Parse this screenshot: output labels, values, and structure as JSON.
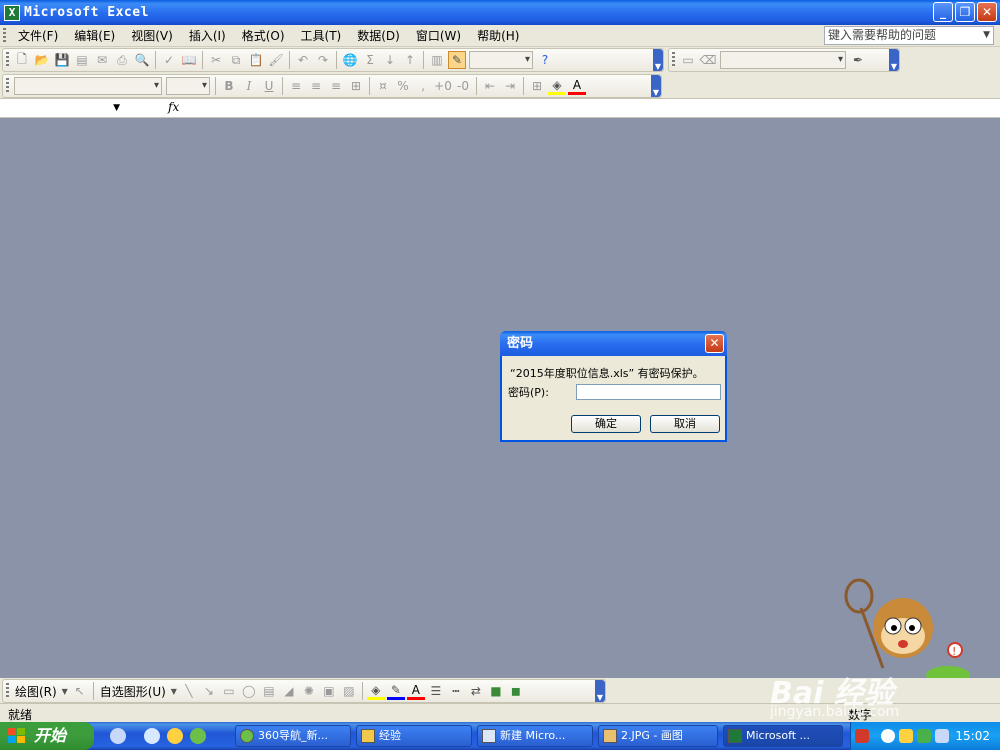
{
  "window": {
    "title": "Microsoft Excel",
    "app_icon": "X",
    "buttons": {
      "minimize": "_",
      "restore": "❐",
      "close": "✕"
    }
  },
  "menu": {
    "items": [
      "文件(F)",
      "编辑(E)",
      "视图(V)",
      "插入(I)",
      "格式(O)",
      "工具(T)",
      "数据(D)",
      "窗口(W)",
      "帮助(H)"
    ],
    "help_placeholder": "键入需要帮助的问题"
  },
  "formula_bar": {
    "fx_label": "fx"
  },
  "dialog": {
    "title": "密码",
    "message": "“2015年度职位信息.xls” 有密码保护。",
    "password_label": "密码(P):",
    "password_value": "",
    "ok_label": "确定",
    "cancel_label": "取消"
  },
  "drawing_toolbar": {
    "draw_label": "绘图(R)",
    "autoshapes_label": "自选图形(U)"
  },
  "status": {
    "left": "就绪",
    "right": "数字"
  },
  "taskbar": {
    "start_label": "开始",
    "tasks": [
      {
        "label": "360导航_新..."
      },
      {
        "label": "经验"
      },
      {
        "label": "新建 Micro..."
      },
      {
        "label": "2.JPG - 画图"
      },
      {
        "label": "Microsoft ..."
      }
    ],
    "clock": "15:02"
  },
  "watermark": {
    "brand": "Bai 经验",
    "url": "jingyan.baidu.com"
  },
  "colors": {
    "titlebar_blue": "#2a6ef0",
    "workspace": "#8a93a8",
    "xp_start_green": "#3d9d3d",
    "close_red": "#c63a14"
  }
}
